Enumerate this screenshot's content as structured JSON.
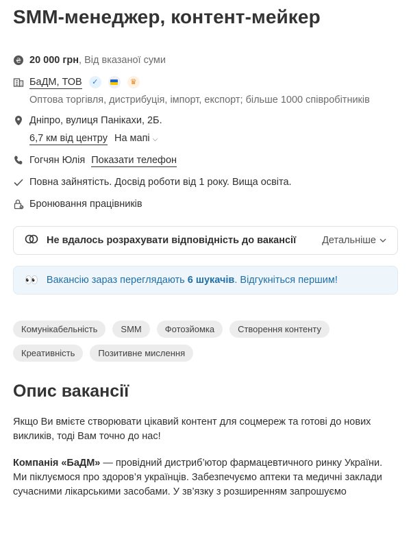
{
  "vacancy": {
    "title": "SMM-менеджер, контент-мейкер"
  },
  "salary": {
    "amount": "20 000 грн",
    "note": ", Від вказаної суми"
  },
  "company": {
    "name": "БаДМ, ТОВ",
    "description": "Оптова торгівля, дистрибуція, імпорт, експорт; більше 1000 співробітників",
    "badges": [
      "verified-check-icon",
      "ukraine-flag-icon",
      "crown-icon"
    ]
  },
  "location": {
    "address": "Дніпро, вулиця Панікахи, 2Б.",
    "distance": "6,7 км від центру",
    "map_label": "На мапі"
  },
  "contact": {
    "name": "Гогчян Юлія",
    "show_phone": "Показати телефон"
  },
  "conditions": "Повна зайнятість. Досвід роботи від 1 року. Вища освіта.",
  "booking": "Бронювання працівників",
  "match": {
    "text": "Не вдалось розрахувати відповідність до вакансії",
    "details": "Детальніше"
  },
  "viewers": {
    "prefix": "Вакансію зараз переглядають ",
    "count_text": "6 шукачів",
    "suffix": ". Відгукніться першим!"
  },
  "tags": [
    "Комунікабельність",
    "SMM",
    "Фотозйомка",
    "Створення контенту",
    "Креативність",
    "Позитивне мислення"
  ],
  "description": {
    "heading": "Опис вакансії",
    "p1": "Якщо Ви вмієте створювати цікавий контент для соцмереж та готові до нових викликів, тоді Вам точно до нас!",
    "p2_bold": "Компанія «БаДМ»",
    "p2_rest": " — провідний дистриб’ютор фармацевтичного ринку України. Ми піклуємося про здоров’я українців. Забезпечуємо аптеки та медичні заклади сучасними лікарськими засобами. У зв’язку з розширенням запрошуємо"
  },
  "colors": {
    "accent_link": "#1f6fa8",
    "viewers_bg": "#eef6fb",
    "tag_bg": "#ececec"
  }
}
